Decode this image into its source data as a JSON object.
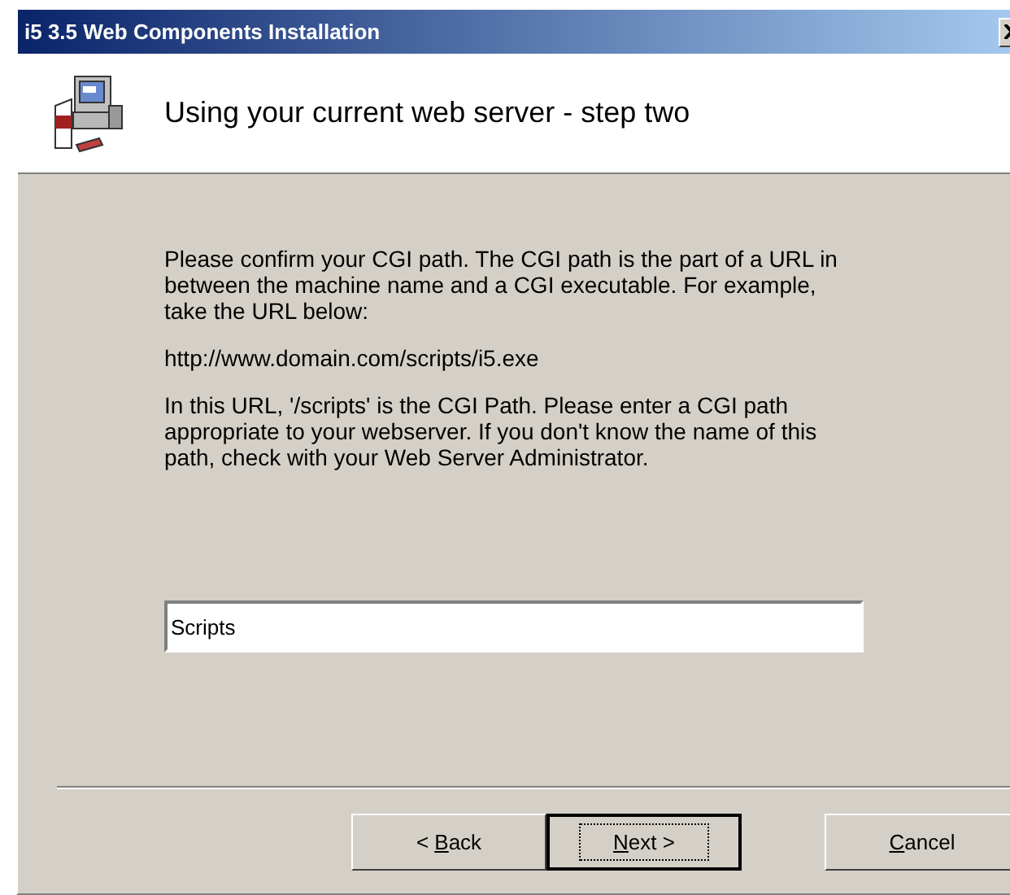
{
  "window": {
    "title": "i5 3.5 Web Components Installation"
  },
  "header": {
    "title": "Using your current web server - step two"
  },
  "paragraphs": [
    "Please confirm your CGI path. The CGI path is the part of a URL in between the machine name and a CGI executable. For example, take the URL below:",
    "http://www.domain.com/scripts/i5.exe",
    "In this URL, '/scripts' is the CGI Path. Please enter a CGI path appropriate to your webserver. If you don't know the name of this path, check with your Web Server Administrator."
  ],
  "cgi_path_field": {
    "value": "Scripts"
  },
  "buttons": [
    {
      "before": "< ",
      "key": "B",
      "after": "ack",
      "default": false
    },
    {
      "key": "N",
      "after": "ext >",
      "default": true
    },
    {
      "key": "C",
      "after": "ancel",
      "default": false
    }
  ]
}
